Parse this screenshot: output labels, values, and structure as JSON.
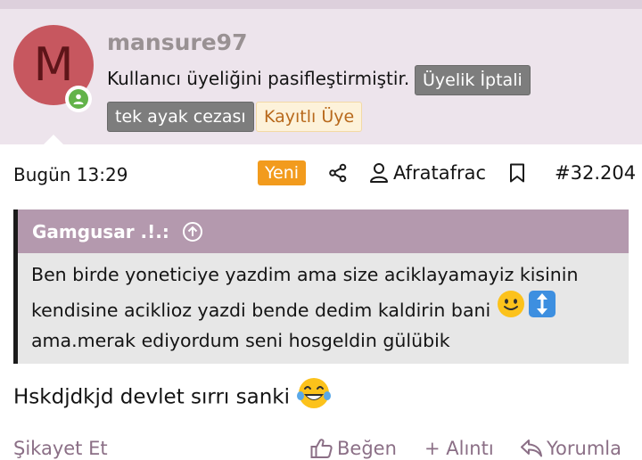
{
  "user": {
    "avatar_letter": "M",
    "username": "mansure97",
    "status_text": "Kullanıcı üyeliğini pasifleştirmiştir.",
    "badges": [
      "Üyelik İptali",
      "tek ayak cezası",
      "Kayıtlı Üye"
    ],
    "online_icon": "person-online-icon"
  },
  "post": {
    "time": "Bugün 13:29",
    "new_label": "Yeni",
    "author": "Afratafrac",
    "number": "#32.204",
    "icons": [
      "share-icon",
      "user-icon",
      "bookmark-icon"
    ]
  },
  "quote": {
    "author": "Gamgusar .!.:",
    "lines": [
      "Ben birde yoneticiye yazdim ama size aciklayamayiz kisinin",
      "kendisine aciklioz yazdi bende dedim kaldirin bani",
      "ama.merak ediyordum seni hosgeldin gülübik"
    ],
    "emojis": [
      "slightly-smiling-face-emoji",
      "up-down-arrow-emoji"
    ]
  },
  "message": {
    "text": "Hskdjdkjd devlet sırrı sanki",
    "emoji": "tears-of-joy-emoji"
  },
  "actions": {
    "report": "Şikayet Et",
    "like": "Beğen",
    "quote": "+ Alıntı",
    "reply": "Yorumla"
  },
  "colors": {
    "header_bg": "#ede4ec",
    "quote_head": "#b499ae",
    "accent_text": "#8b6f86",
    "new_badge": "#f29b1d",
    "avatar": "#c7575f"
  }
}
